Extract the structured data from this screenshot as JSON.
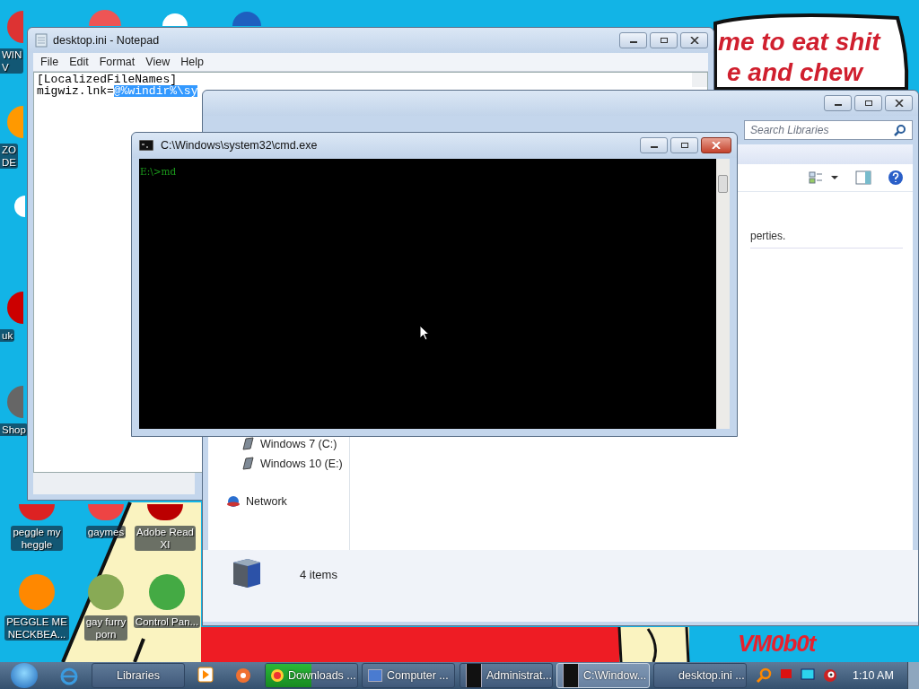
{
  "wallpaper": {
    "bubble_lines": [
      "me to eat shit",
      "e and chew"
    ],
    "logo": "VM0b0t"
  },
  "desktop_icons": [
    {
      "lines": [
        "WIN",
        "V"
      ]
    },
    {
      "lines": [
        "ZO",
        "DE"
      ]
    },
    {
      "lines": [
        "uk"
      ]
    },
    {
      "lines": [
        "Shop"
      ]
    },
    {
      "lines": [
        "peggle my",
        "heggle"
      ]
    },
    {
      "lines": [
        "gaymes"
      ]
    },
    {
      "lines": [
        "Adobe Read",
        "XI"
      ]
    },
    {
      "lines": [
        "PEGGLE ME",
        "NECKBEA..."
      ]
    },
    {
      "lines": [
        "gay furry",
        "porn"
      ]
    },
    {
      "lines": [
        "Control Pan..."
      ]
    }
  ],
  "notepad": {
    "title": "desktop.ini - Notepad",
    "menu": [
      "File",
      "Edit",
      "Format",
      "View",
      "Help"
    ],
    "lines": [
      {
        "text": "[LocalizedFileNames]"
      },
      {
        "text": "migwiz.lnk=",
        "selected_text": "@%windir%\\sy"
      }
    ]
  },
  "explorer": {
    "search": {
      "placeholder": "Search Libraries"
    },
    "content_text": "perties.",
    "nav_items": [
      {
        "label": "Windows 7 (C:)",
        "kind": "drive"
      },
      {
        "label": "Windows 10 (E:)",
        "kind": "drive"
      },
      {
        "label": "Network",
        "kind": "network"
      }
    ],
    "status": "4 items"
  },
  "cmd": {
    "title": "C:\\Windows\\system32\\cmd.exe",
    "lines": [
      "E:\\>md"
    ]
  },
  "taskbar": {
    "buttons": [
      {
        "label": "Libraries",
        "kind": "explorer",
        "selected": false
      },
      {
        "label": "Downloads ...",
        "kind": "chrome",
        "selected": false,
        "level": 0.5
      },
      {
        "label": "Computer ...",
        "kind": "computer",
        "selected": false
      },
      {
        "label": "Administrat...",
        "kind": "console",
        "selected": false
      },
      {
        "label": "C:\\Window...",
        "kind": "console",
        "selected": true
      },
      {
        "label": "desktop.ini ...",
        "kind": "notepad",
        "selected": false
      }
    ],
    "clock": "1:10 AM"
  }
}
